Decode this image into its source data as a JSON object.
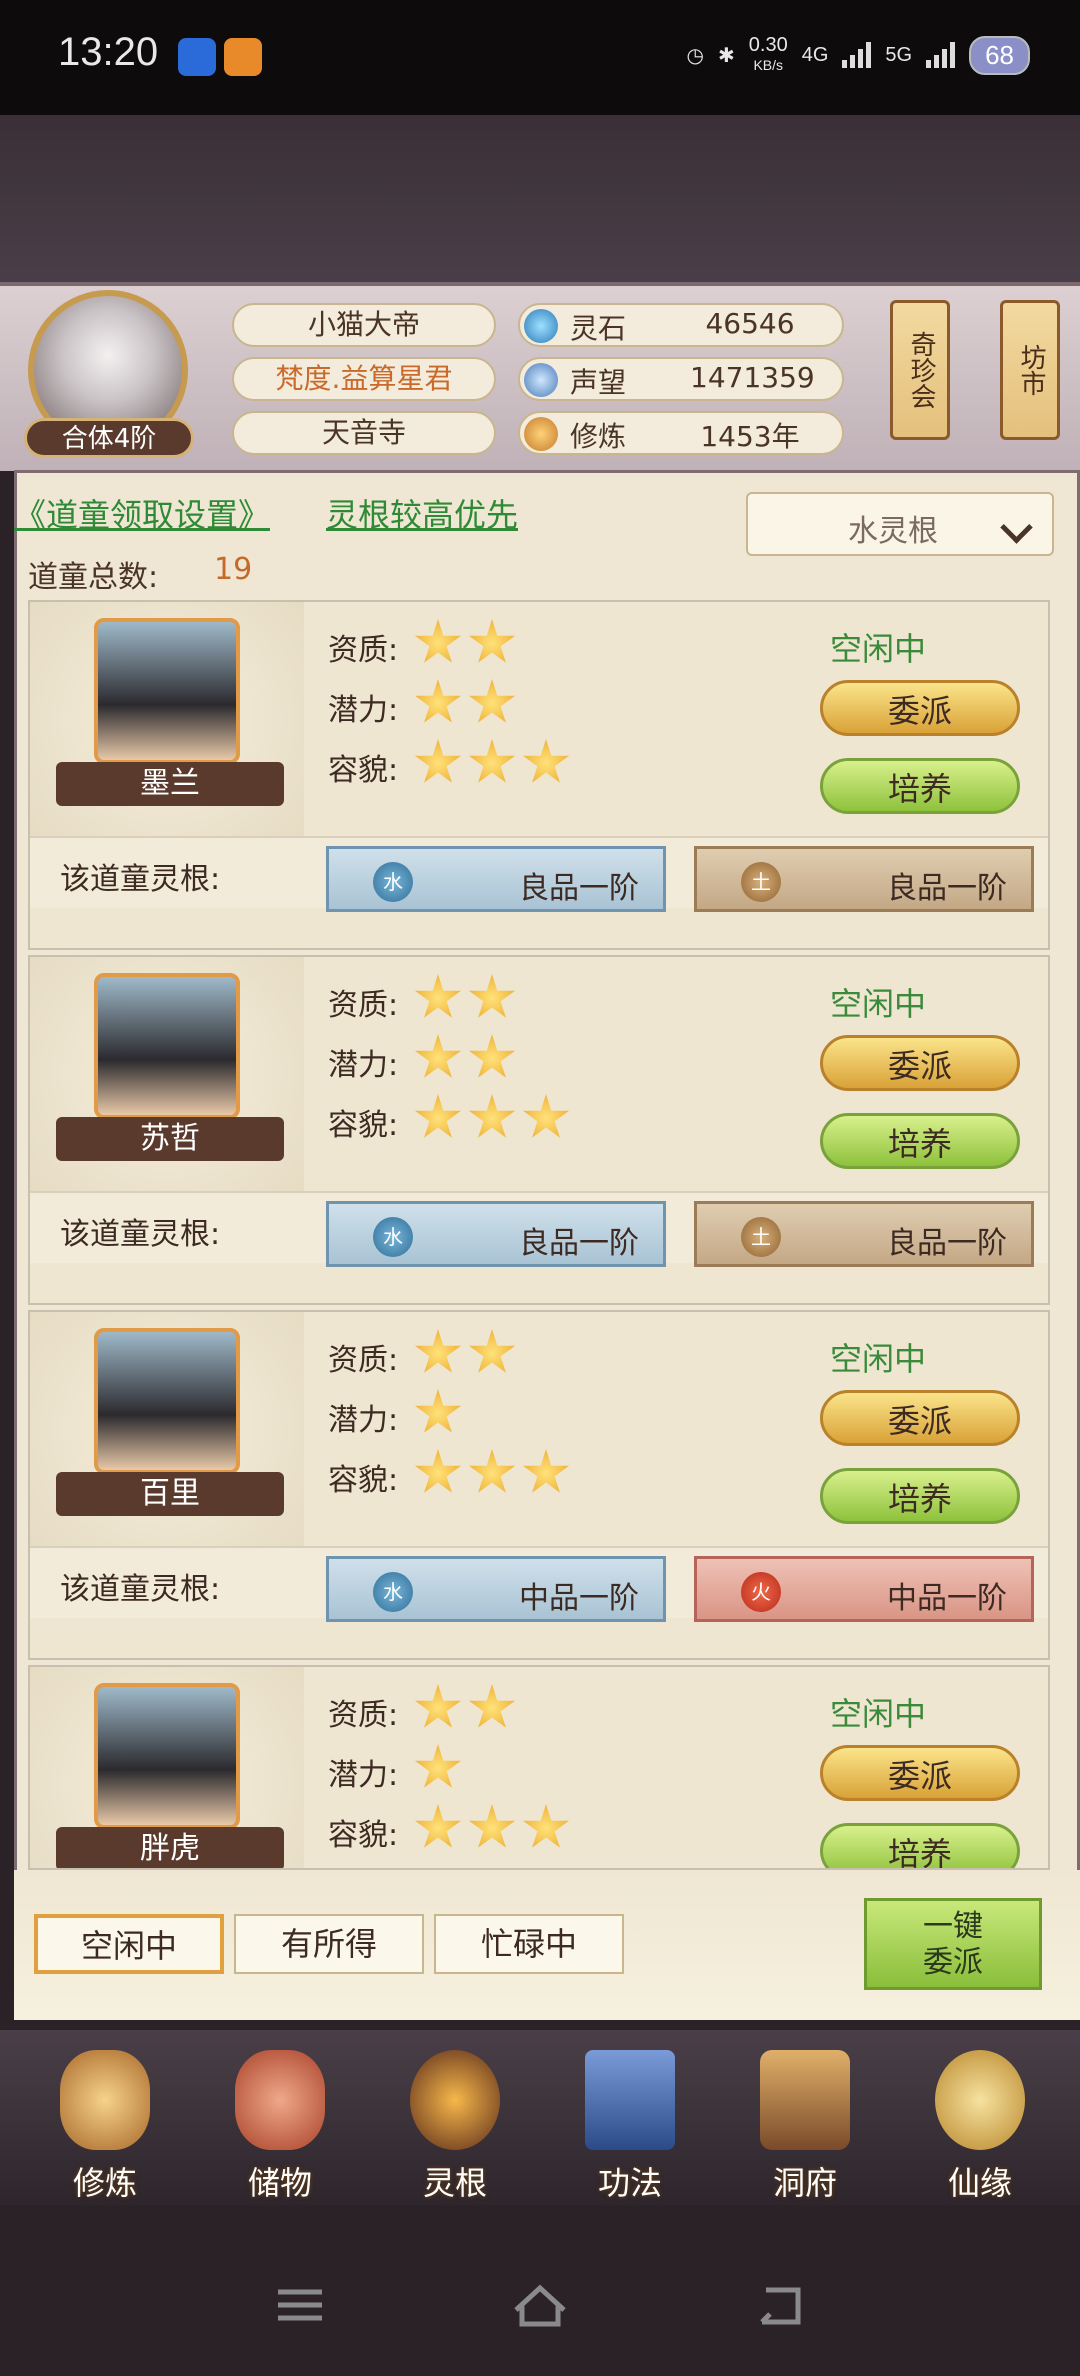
{
  "status": {
    "time": "13:20",
    "net_speed": "0.30",
    "net_unit": "KB/s",
    "sim1": "4G",
    "sim2": "5G",
    "battery": "68"
  },
  "player": {
    "realm": "合体4阶",
    "name": "小猫大帝",
    "title": "梵度.益算星君",
    "sect": "天音寺"
  },
  "resources": [
    {
      "label": "灵石",
      "value": "46546",
      "icon": "spirit-stone-icon"
    },
    {
      "label": "声望",
      "value": "1471359",
      "icon": "reputation-icon"
    },
    {
      "label": "修炼",
      "value": "1453年",
      "icon": "cultivation-icon"
    }
  ],
  "side_buttons": {
    "treasure": "奇珍会",
    "market": "坊市"
  },
  "settings_link": "《道童领取设置》",
  "priority_link": "灵根较高优先",
  "dropdown": {
    "value": "水灵根"
  },
  "count": {
    "label": "道童总数:",
    "value": "19"
  },
  "attr_labels": {
    "quality": "资质:",
    "potential": "潜力:",
    "appearance": "容貌:"
  },
  "root_label": "该道童灵根:",
  "status_idle": "空闲中",
  "btn_assign": "委派",
  "btn_train": "培养",
  "disciples": [
    {
      "name": "墨兰",
      "quality": 2,
      "potential": 2,
      "appearance": 3,
      "roots": [
        {
          "element": "水",
          "grade": "良品一阶",
          "type": "water"
        },
        {
          "element": "土",
          "grade": "良品一阶",
          "type": "earth"
        }
      ]
    },
    {
      "name": "苏哲",
      "quality": 2,
      "potential": 2,
      "appearance": 3,
      "roots": [
        {
          "element": "水",
          "grade": "良品一阶",
          "type": "water"
        },
        {
          "element": "土",
          "grade": "良品一阶",
          "type": "earth"
        }
      ]
    },
    {
      "name": "百里",
      "quality": 2,
      "potential": 1,
      "appearance": 3,
      "roots": [
        {
          "element": "水",
          "grade": "中品一阶",
          "type": "water"
        },
        {
          "element": "火",
          "grade": "中品一阶",
          "type": "fire"
        }
      ]
    },
    {
      "name": "胖虎",
      "quality": 2,
      "potential": 1,
      "appearance": 3,
      "roots": []
    }
  ],
  "filters": [
    "空闲中",
    "有所得",
    "忙碌中"
  ],
  "one_key": "一键\n委派",
  "nav": [
    {
      "label": "修炼",
      "icon": "cultivate-icon",
      "color": "#d9a04a"
    },
    {
      "label": "储物",
      "icon": "storage-bag-icon",
      "color": "#c9604a"
    },
    {
      "label": "灵根",
      "icon": "spirit-root-icon",
      "color": "#c47a2a"
    },
    {
      "label": "功法",
      "icon": "technique-book-icon",
      "color": "#4a6aa8"
    },
    {
      "label": "洞府",
      "icon": "cave-mansion-icon",
      "color": "#a86a3a"
    },
    {
      "label": "仙缘",
      "icon": "fortune-gourd-icon",
      "color": "#d9a04a"
    }
  ]
}
